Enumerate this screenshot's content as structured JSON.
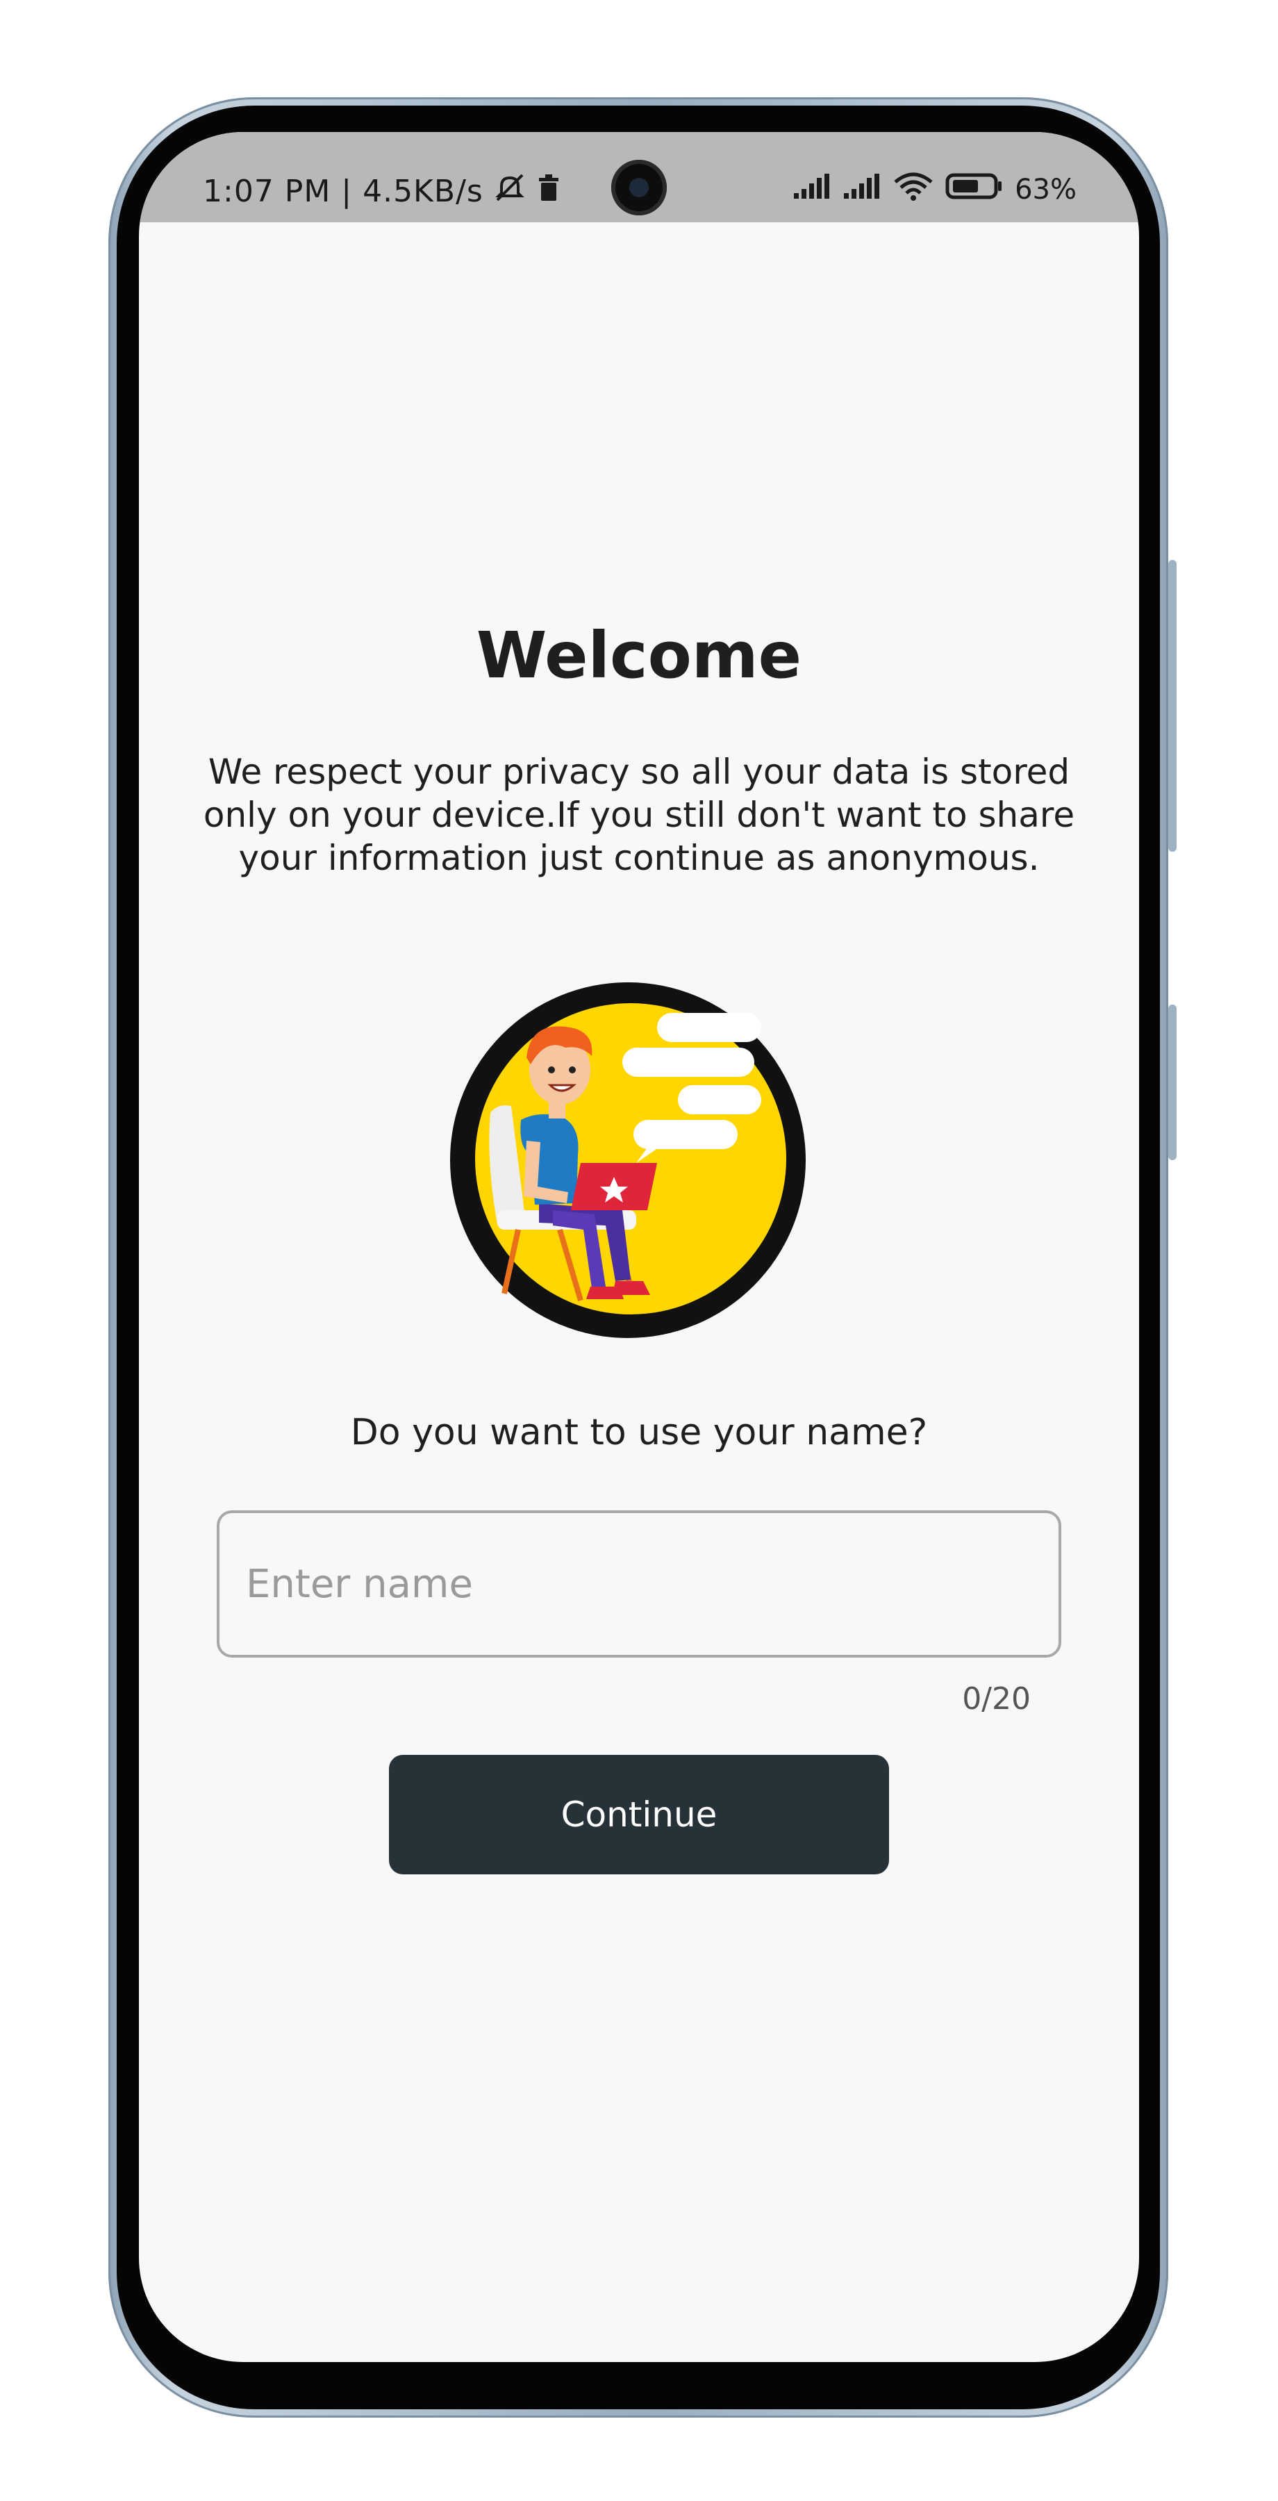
{
  "status_bar": {
    "time_and_speed": "1:07 PM | 4.5KB/s",
    "battery_percent": "63%",
    "icons": [
      "mute-icon",
      "trash-icon",
      "signal-icon",
      "signal-icon",
      "wifi-icon",
      "battery-icon"
    ]
  },
  "welcome": {
    "title": "Welcome",
    "description": "We respect your privacy so all your data is stored only on your device.If you still don't want to share your information just continue as anonymous."
  },
  "illustration": {
    "icon": "person-with-laptop-illustration",
    "colors": {
      "circle_fill": "#FFD600",
      "ring": "#111111"
    }
  },
  "name_form": {
    "question": "Do you want to use your name?",
    "input_placeholder": "Enter name",
    "input_value": "",
    "char_counter": "0/20"
  },
  "actions": {
    "continue_label": "Continue"
  },
  "colors": {
    "background": "#f8f8f8",
    "button": "#263238",
    "status_bar": "#b8b8b8"
  }
}
